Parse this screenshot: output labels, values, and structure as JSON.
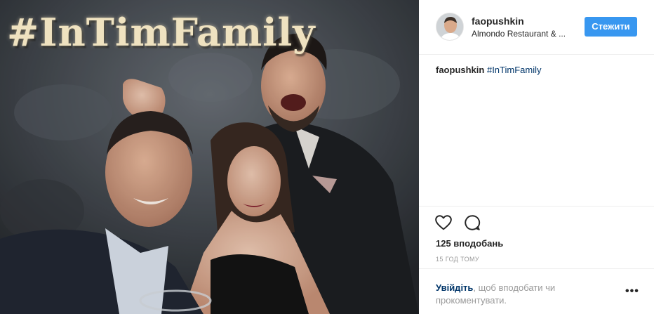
{
  "post": {
    "photo": {
      "sign_text": "#InTimFamily"
    },
    "header": {
      "username": "faopushkin",
      "location": "Almondo Restaurant & ...",
      "follow_label": "Стежити"
    },
    "caption": {
      "username": "faopushkin",
      "hashtag": "#InTimFamily"
    },
    "actions": {
      "like_icon": "heart-icon",
      "comment_icon": "comment-icon",
      "likes": "125 вподобань",
      "timestamp": "15 ГОД ТОМУ"
    },
    "footer": {
      "login_link": "Увійдіть",
      "login_rest": ", щоб вподобати чи прокоментувати.",
      "more_icon": "more-options-icon",
      "more_glyph": "•••"
    }
  },
  "colors": {
    "accent": "#3897f0",
    "link": "#003569",
    "muted": "#999999",
    "text": "#262626"
  }
}
